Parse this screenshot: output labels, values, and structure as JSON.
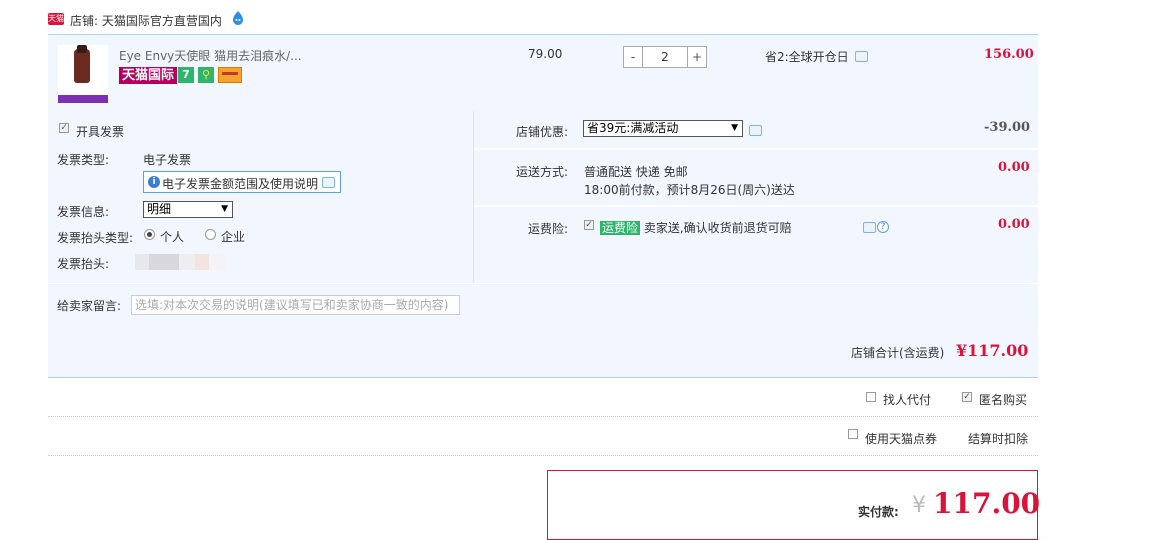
{
  "shop": {
    "badge_text": "天猫",
    "label": "店铺: 天猫国际官方直营国内",
    "accent": "#d8143a"
  },
  "item": {
    "title": "Eye Envy天使眼 猫用去泪痕水/...",
    "badge_tmall_intl": "天猫国际",
    "badge_seven": "7",
    "badge_bulb": "⚲",
    "unit_price": "79.00",
    "quantity": "2",
    "minus_label": "-",
    "plus_label": "+",
    "promo_text": "省2:全球开仓日",
    "subtotal": "156.00"
  },
  "invoice": {
    "checkbox_label": "开具发票",
    "type_label": "发票类型:",
    "type_value": "电子发票",
    "scope_link": "电子发票金额范围及使用说明",
    "info_label": "发票信息:",
    "info_select": "明细",
    "title_type_label": "发票抬头类型:",
    "title_type_options": [
      "个人",
      "企业"
    ],
    "title_label": "发票抬头:"
  },
  "order": {
    "discount_label": "店铺优惠:",
    "discount_select": "省39元:满减活动",
    "discount_amount": "-39.00",
    "shipping_label": "运送方式:",
    "shipping_line1": "普通配送 快递 免邮",
    "shipping_line2": "18:00前付款，预计8月26日(周六)送达",
    "shipping_amount": "0.00",
    "insurance_label": "运费险:",
    "insurance_tag": "运费险",
    "insurance_text": "卖家送,确认收货前退货可赔",
    "insurance_amount": "0.00"
  },
  "message": {
    "label": "给卖家留言:",
    "placeholder": "选填:对本次交易的说明(建议填写已和卖家协商一致的内容)"
  },
  "total": {
    "label": "店铺合计(含运费)",
    "amount": "¥117.00"
  },
  "options": {
    "proxy_pay": "找人代付",
    "anonymous": "匿名购买",
    "tmall_points": "使用天猫点券",
    "deduct_note": "结算时扣除"
  },
  "pay": {
    "label": "实付款:",
    "yen": "¥",
    "amount": "117.00"
  }
}
